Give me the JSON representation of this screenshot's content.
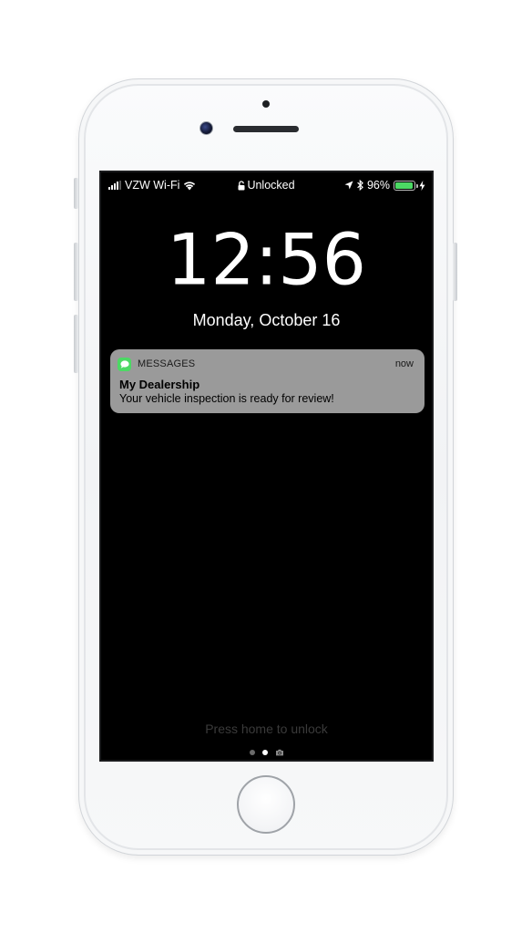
{
  "status_bar": {
    "carrier": "VZW Wi-Fi",
    "lock_status": "Unlocked",
    "battery_percent": "96%",
    "battery_level": 0.96,
    "icons": [
      "signal-icon",
      "wifi-icon",
      "padlock-icon",
      "location-arrow-icon",
      "bluetooth-icon",
      "battery-icon",
      "charging-bolt-icon"
    ]
  },
  "lock_screen": {
    "time": "12:56",
    "date": "Monday, October 16",
    "unlock_hint": "Press home to unlock",
    "page_count": 3,
    "active_page": 1
  },
  "notification": {
    "app_name": "MESSAGES",
    "app_icon": "messages-bubble-icon",
    "time": "now",
    "title": "My Dealership",
    "body": "Your vehicle inspection is ready for review!"
  },
  "colors": {
    "screen_background": "#000000",
    "notification_background": "#9a9a9a",
    "messages_green": "#4cd964",
    "battery_green": "#4cd964",
    "phone_body": "#f4f5f7"
  }
}
